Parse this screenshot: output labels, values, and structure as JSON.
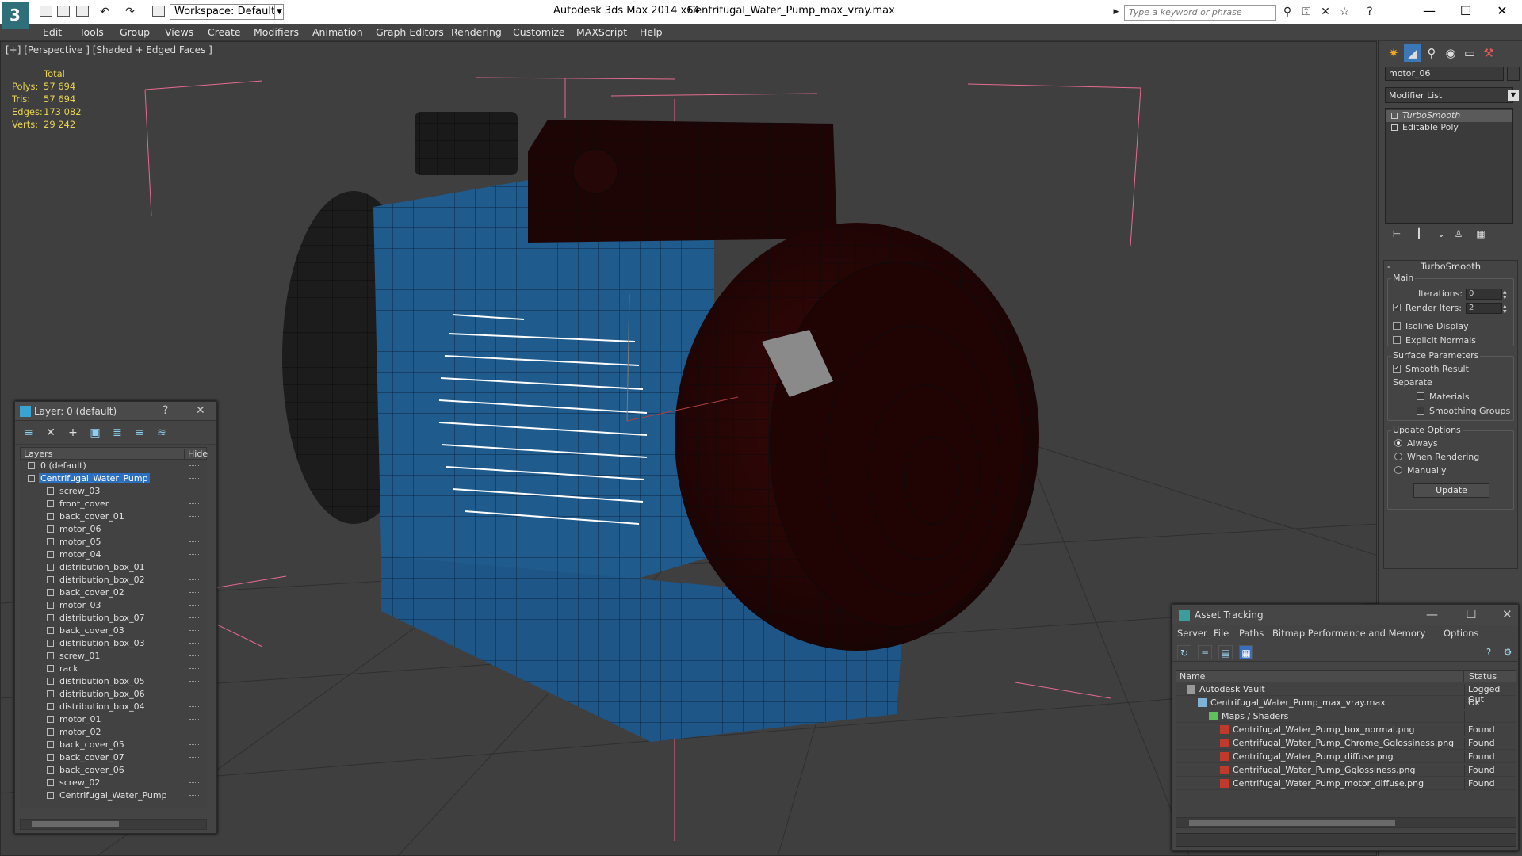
{
  "titlebar": {
    "logo": "3",
    "workspace": "Workspace: Default",
    "app_title": "Autodesk 3ds Max  2014 x64",
    "file_title": "Centrifugal_Water_Pump_max_vray.max",
    "search_placeholder": "Type a keyword or phrase"
  },
  "menu": [
    "Edit",
    "Tools",
    "Group",
    "Views",
    "Create",
    "Modifiers",
    "Animation",
    "Graph Editors",
    "Rendering",
    "Customize",
    "MAXScript",
    "Help"
  ],
  "viewport": {
    "label": "[+] [Perspective ] [Shaded + Edged Faces ]",
    "stats": {
      "header": "Total",
      "polys_label": "Polys:",
      "polys": "57 694",
      "tris_label": "Tris:",
      "tris": "57 694",
      "edges_label": "Edges:",
      "edges": "173 082",
      "verts_label": "Verts:",
      "verts": "29 242"
    }
  },
  "layer_panel": {
    "title": "Layer: 0 (default)",
    "help": "?",
    "close": "✕",
    "col_layers": "Layers",
    "col_hide": "Hide",
    "rows": [
      {
        "name": "0 (default)",
        "level": 1,
        "type": "layer"
      },
      {
        "name": "Centrifugal_Water_Pump",
        "level": 1,
        "type": "layer",
        "selected": true
      },
      {
        "name": "screw_03",
        "level": 2,
        "type": "object"
      },
      {
        "name": "front_cover",
        "level": 2,
        "type": "object"
      },
      {
        "name": "back_cover_01",
        "level": 2,
        "type": "object"
      },
      {
        "name": "motor_06",
        "level": 2,
        "type": "object"
      },
      {
        "name": "motor_05",
        "level": 2,
        "type": "object"
      },
      {
        "name": "motor_04",
        "level": 2,
        "type": "object"
      },
      {
        "name": "distribution_box_01",
        "level": 2,
        "type": "object"
      },
      {
        "name": "distribution_box_02",
        "level": 2,
        "type": "object"
      },
      {
        "name": "back_cover_02",
        "level": 2,
        "type": "object"
      },
      {
        "name": "motor_03",
        "level": 2,
        "type": "object"
      },
      {
        "name": "distribution_box_07",
        "level": 2,
        "type": "object"
      },
      {
        "name": "back_cover_03",
        "level": 2,
        "type": "object"
      },
      {
        "name": "distribution_box_03",
        "level": 2,
        "type": "object"
      },
      {
        "name": "screw_01",
        "level": 2,
        "type": "object"
      },
      {
        "name": "rack",
        "level": 2,
        "type": "object"
      },
      {
        "name": "distribution_box_05",
        "level": 2,
        "type": "object"
      },
      {
        "name": "distribution_box_06",
        "level": 2,
        "type": "object"
      },
      {
        "name": "distribution_box_04",
        "level": 2,
        "type": "object"
      },
      {
        "name": "motor_01",
        "level": 2,
        "type": "object"
      },
      {
        "name": "motor_02",
        "level": 2,
        "type": "object"
      },
      {
        "name": "back_cover_05",
        "level": 2,
        "type": "object"
      },
      {
        "name": "back_cover_07",
        "level": 2,
        "type": "object"
      },
      {
        "name": "back_cover_06",
        "level": 2,
        "type": "object"
      },
      {
        "name": "screw_02",
        "level": 2,
        "type": "object"
      },
      {
        "name": "Centrifugal_Water_Pump",
        "level": 2,
        "type": "object"
      }
    ]
  },
  "command_panel": {
    "object_name": "motor_06",
    "modifier_list": "Modifier List",
    "stack": [
      "TurboSmooth",
      "Editable Poly"
    ],
    "turbosmooth": {
      "title": "TurboSmooth",
      "main": "Main",
      "iterations_label": "Iterations:",
      "iterations": "0",
      "render_iters_label": "Render Iters:",
      "render_iters": "2",
      "isoline": "Isoline Display",
      "explicit_normals": "Explicit Normals",
      "surface_params": "Surface Parameters",
      "smooth_result": "Smooth Result",
      "separate": "Separate",
      "materials": "Materials",
      "smoothing_groups": "Smoothing Groups",
      "update_options": "Update Options",
      "always": "Always",
      "when_rendering": "When Rendering",
      "manually": "Manually",
      "update_button": "Update"
    }
  },
  "asset_tracking": {
    "title": "Asset Tracking",
    "menu": [
      "Server",
      "File",
      "Paths",
      "Bitmap Performance and Memory",
      "Options"
    ],
    "col_name": "Name",
    "col_status": "Status",
    "rows": [
      {
        "name": "Autodesk Vault",
        "status": "Logged Out",
        "level": 0,
        "icon": "vault"
      },
      {
        "name": "Centrifugal_Water_Pump_max_vray.max",
        "status": "Ok",
        "level": 1,
        "icon": "file"
      },
      {
        "name": "Maps / Shaders",
        "status": "",
        "level": 2,
        "icon": "maps"
      },
      {
        "name": "Centrifugal_Water_Pump_box_normal.png",
        "status": "Found",
        "level": 3,
        "icon": "png"
      },
      {
        "name": "Centrifugal_Water_Pump_Chrome_Gglossiness.png",
        "status": "Found",
        "level": 3,
        "icon": "png"
      },
      {
        "name": "Centrifugal_Water_Pump_diffuse.png",
        "status": "Found",
        "level": 3,
        "icon": "png"
      },
      {
        "name": "Centrifugal_Water_Pump_Gglossiness.png",
        "status": "Found",
        "level": 3,
        "icon": "png"
      },
      {
        "name": "Centrifugal_Water_Pump_motor_diffuse.png",
        "status": "Found",
        "level": 3,
        "icon": "png"
      }
    ]
  }
}
